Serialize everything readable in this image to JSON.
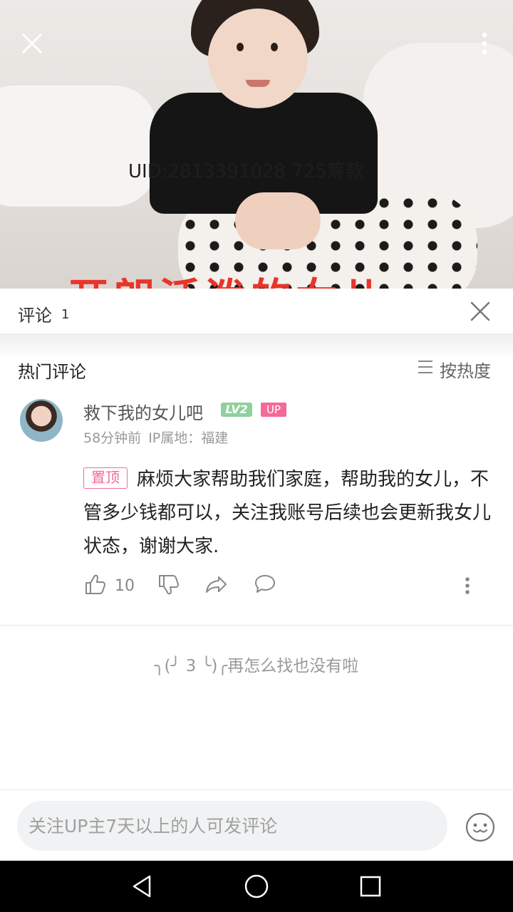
{
  "hero": {
    "uid_text": "UID:2813391028 725筹款",
    "banner_text": "开朗活泼的女儿"
  },
  "comments": {
    "title": "评论",
    "count": "1"
  },
  "hot": {
    "title": "热门评论",
    "sort_label": "按热度"
  },
  "comment": {
    "username": "救下我的女儿吧",
    "level": "LV2",
    "up_badge": "UP",
    "time": "58分钟前",
    "ip": "IP属地：福建",
    "pin_label": "置顶",
    "text": "麻烦大家帮助我们家庭，帮助我的女儿，不管多少钱都可以，关注我账号后续也会更新我女儿状态，谢谢大家.",
    "likes": "10"
  },
  "end_message": "╮(╯ 3 ╰)╭再怎么找也没有啦",
  "input": {
    "placeholder": "关注UP主7天以上的人可发评论"
  },
  "colors": {
    "accent_pink": "#f36b98",
    "level_green": "#8fd19b"
  }
}
